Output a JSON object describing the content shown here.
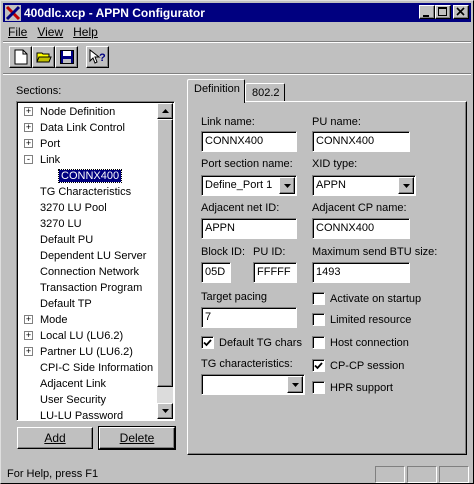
{
  "window": {
    "title": "400dlc.xcp - APPN Configurator"
  },
  "menu": {
    "file": "File",
    "view": "View",
    "help": "Help"
  },
  "toolbar": {
    "icons": [
      "new-file-icon",
      "open-folder-icon",
      "save-icon",
      "context-help-icon"
    ]
  },
  "sections": {
    "label": "Sections:",
    "items": [
      {
        "label": "Node Definition",
        "expander": "+",
        "indent": 0
      },
      {
        "label": "Data Link Control",
        "expander": "+",
        "indent": 0
      },
      {
        "label": "Port",
        "expander": "+",
        "indent": 0
      },
      {
        "label": "Link",
        "expander": "-",
        "indent": 0
      },
      {
        "label": "CONNX400",
        "expander": "",
        "indent": 1,
        "selected": true
      },
      {
        "label": "TG Characteristics",
        "expander": "",
        "indent": 0
      },
      {
        "label": "3270 LU Pool",
        "expander": "",
        "indent": 0
      },
      {
        "label": "3270 LU",
        "expander": "",
        "indent": 0
      },
      {
        "label": "Default PU",
        "expander": "",
        "indent": 0
      },
      {
        "label": "Dependent LU Server",
        "expander": "",
        "indent": 0
      },
      {
        "label": "Connection Network",
        "expander": "",
        "indent": 0
      },
      {
        "label": "Transaction Program",
        "expander": "",
        "indent": 0
      },
      {
        "label": "Default TP",
        "expander": "",
        "indent": 0
      },
      {
        "label": "Mode",
        "expander": "+",
        "indent": 0
      },
      {
        "label": "Local LU (LU6.2)",
        "expander": "+",
        "indent": 0
      },
      {
        "label": "Partner LU (LU6.2)",
        "expander": "+",
        "indent": 0
      },
      {
        "label": "CPI-C Side Information",
        "expander": "",
        "indent": 0
      },
      {
        "label": "Adjacent Link",
        "expander": "",
        "indent": 0
      },
      {
        "label": "User Security",
        "expander": "",
        "indent": 0
      },
      {
        "label": "LU-LU Password",
        "expander": "",
        "indent": 0
      }
    ],
    "add_label": "Add",
    "delete_label": "Delete"
  },
  "tabs": [
    {
      "label": "Definition",
      "active": true
    },
    {
      "label": "802.2",
      "active": false
    }
  ],
  "form": {
    "link_name_label": "Link name:",
    "link_name_value": "CONNX400",
    "pu_name_label": "PU name:",
    "pu_name_value": "CONNX400",
    "port_section_label": "Port section name:",
    "port_section_value": "Define_Port 1",
    "xid_type_label": "XID type:",
    "xid_type_value": "APPN",
    "adjacent_net_label": "Adjacent net ID:",
    "adjacent_net_value": "APPN",
    "adjacent_cp_label": "Adjacent CP name:",
    "adjacent_cp_value": "CONNX400",
    "block_id_label": "Block ID:",
    "block_id_value": "05D",
    "pu_id_label": "PU ID:",
    "pu_id_value": "FFFFF",
    "max_btu_label": "Maximum send BTU size:",
    "max_btu_value": "1493",
    "target_pacing_label": "Target pacing",
    "target_pacing_value": "7",
    "tg_char_label": "TG characteristics:",
    "tg_char_value": "",
    "checks": {
      "activate_startup": {
        "label": "Activate on startup",
        "checked": false
      },
      "limited_resource": {
        "label": "Limited resource",
        "checked": false
      },
      "host_connection": {
        "label": "Host connection",
        "checked": false
      },
      "cp_cp_session": {
        "label": "CP-CP session",
        "checked": true
      },
      "hpr_support": {
        "label": "HPR support",
        "checked": false
      },
      "default_tg_chars": {
        "label": "Default TG chars",
        "checked": true
      }
    }
  },
  "status": {
    "text": "For Help, press F1"
  }
}
